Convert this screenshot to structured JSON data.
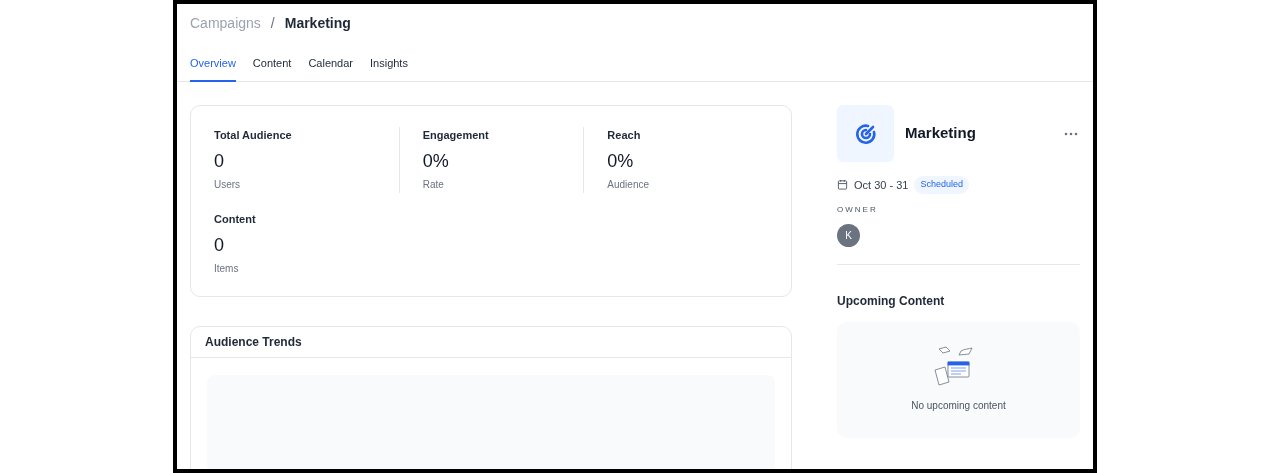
{
  "breadcrumb": {
    "parent": "Campaigns",
    "separator": "/",
    "current": "Marketing"
  },
  "tabs": [
    {
      "label": "Overview",
      "selected": true
    },
    {
      "label": "Content",
      "selected": false
    },
    {
      "label": "Calendar",
      "selected": false
    },
    {
      "label": "Insights",
      "selected": false
    }
  ],
  "stats": [
    {
      "label": "Total Audience",
      "value": "0",
      "unit": "Users"
    },
    {
      "label": "Engagement",
      "value": "0%",
      "unit": "Rate"
    },
    {
      "label": "Reach",
      "value": "0%",
      "unit": "Audience"
    },
    {
      "label": "Content",
      "value": "0",
      "unit": "Items"
    }
  ],
  "audience_trends": {
    "title": "Audience Trends"
  },
  "campaign": {
    "name": "Marketing",
    "dates": "Oct 30 - 31",
    "status": "Scheduled",
    "owner_label": "OWNER",
    "owner_initial": "K"
  },
  "upcoming": {
    "title": "Upcoming Content",
    "empty_message": "No upcoming content"
  }
}
